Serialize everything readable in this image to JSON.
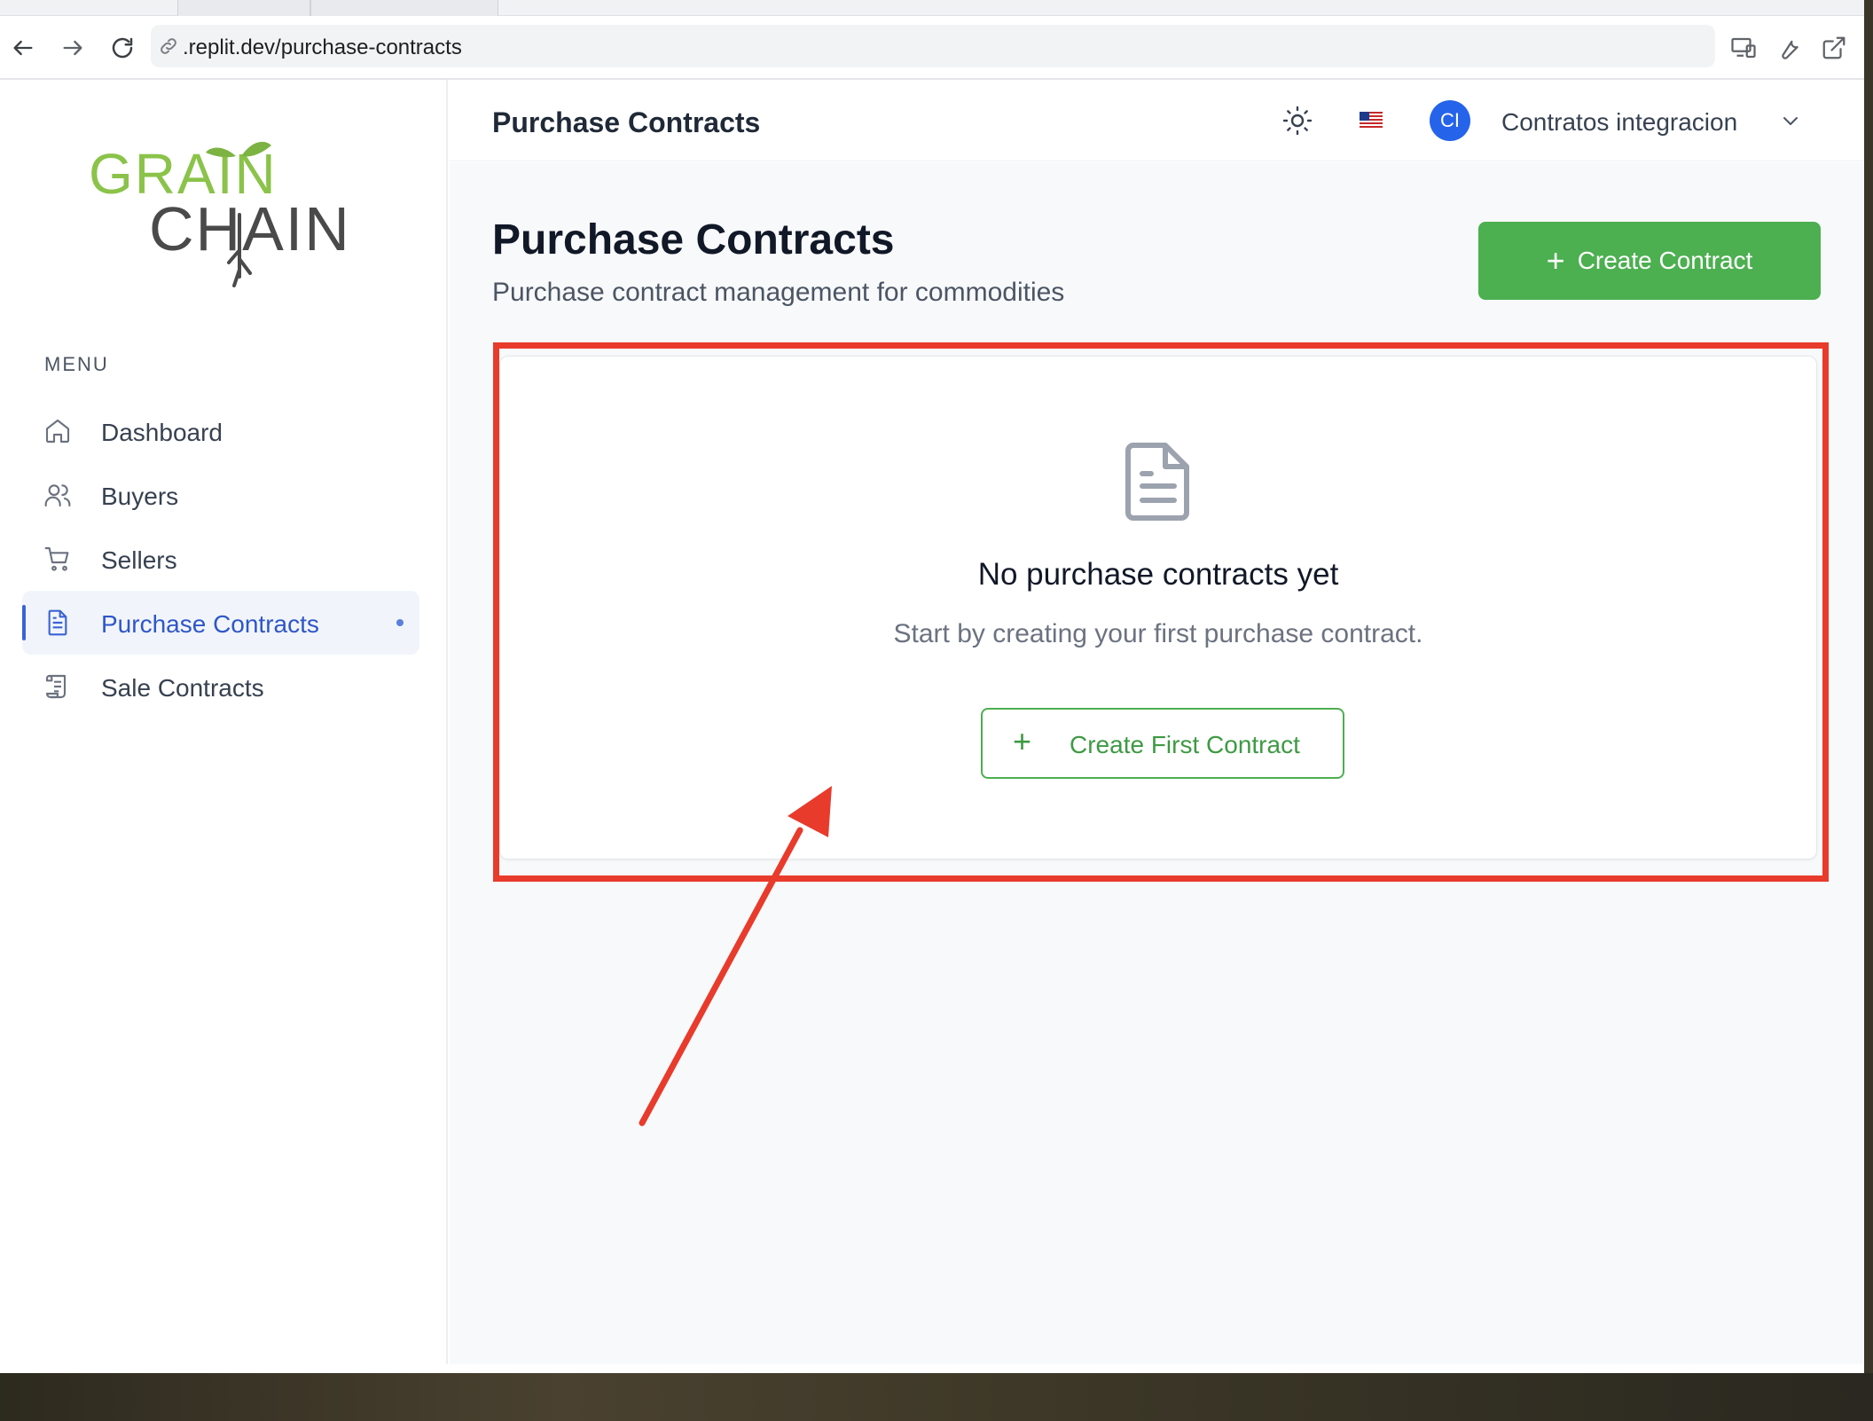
{
  "browser": {
    "url": ".replit.dev/purchase-contracts"
  },
  "sidebar": {
    "logo_text": [
      "GRAIN",
      "CHAIN"
    ],
    "menu_title": "MENU",
    "items": [
      {
        "label": "Dashboard",
        "icon": "home-icon"
      },
      {
        "label": "Buyers",
        "icon": "users-icon"
      },
      {
        "label": "Sellers",
        "icon": "cart-icon"
      },
      {
        "label": "Purchase Contracts",
        "icon": "document-icon",
        "active": true
      },
      {
        "label": "Sale Contracts",
        "icon": "scroll-icon"
      }
    ]
  },
  "header": {
    "title": "Purchase Contracts",
    "avatar_initials": "CI",
    "user_name": "Contratos integracion"
  },
  "main": {
    "title": "Purchase Contracts",
    "subtitle": "Purchase contract management for commodities",
    "create_button": "Create Contract",
    "empty_state": {
      "title": "No purchase contracts yet",
      "subtitle": "Start by creating your first purchase contract.",
      "button": "Create First Contract"
    }
  },
  "colors": {
    "brand_green": "#4caf50",
    "accent_blue": "#2f56c9",
    "annotation_red": "#e83b2c"
  }
}
